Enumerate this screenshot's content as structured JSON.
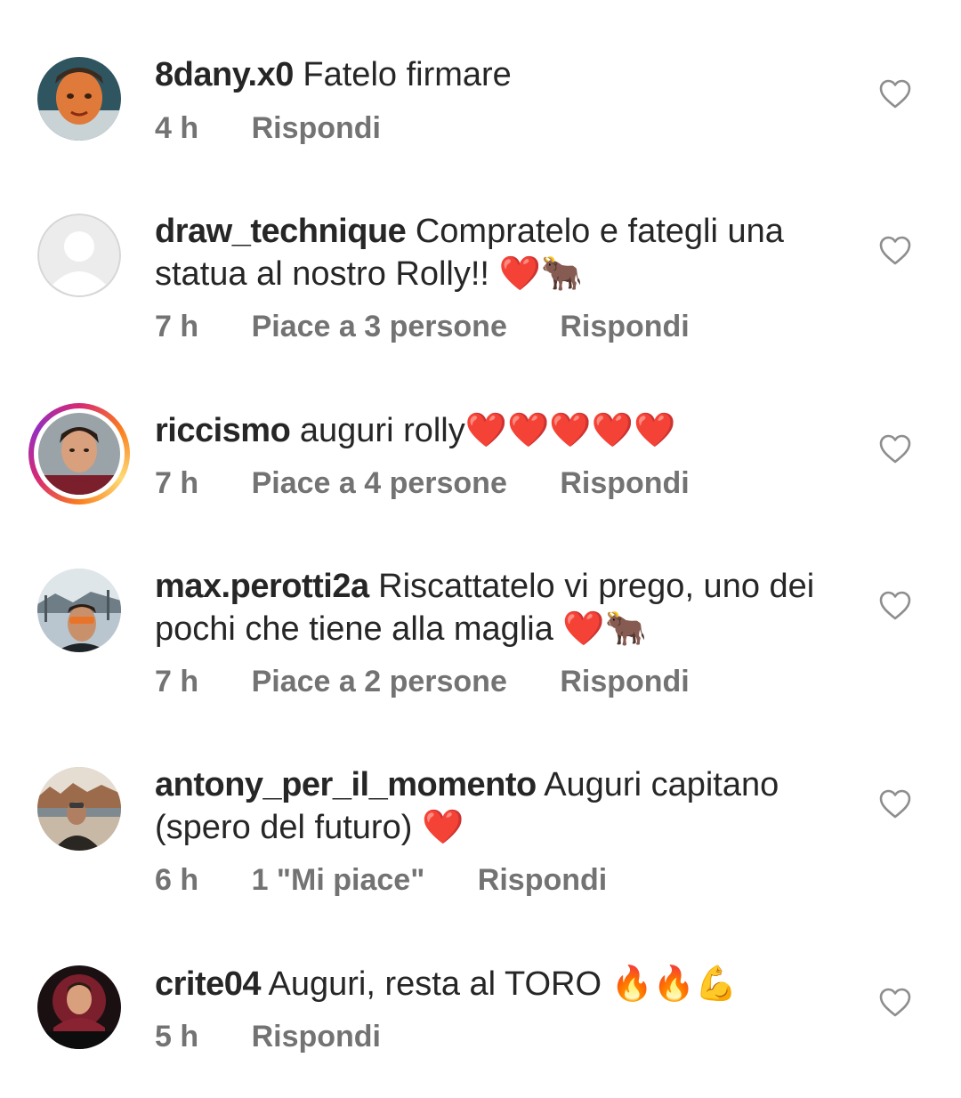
{
  "comments": [
    {
      "username": "8dany.x0",
      "text": "Fatelo firmare",
      "emoji": "",
      "time": "4 h",
      "likes": "",
      "reply": "Rispondi",
      "has_story": false
    },
    {
      "username": "draw_technique",
      "text": "Compratelo e fategli una statua al nostro Rolly!!",
      "emoji": "❤️🐂",
      "time": "7 h",
      "likes": "Piace a 3 persone",
      "reply": "Rispondi",
      "has_story": false
    },
    {
      "username": "riccismo",
      "text": "auguri rolly",
      "emoji": "❤️❤️❤️❤️❤️",
      "time": "7 h",
      "likes": "Piace a 4 persone",
      "reply": "Rispondi",
      "has_story": true
    },
    {
      "username": "max.perotti2a",
      "text": "Riscattatelo vi prego, uno dei pochi che tiene alla maglia",
      "emoji": "❤️🐂",
      "time": "7 h",
      "likes": "Piace a 2 persone",
      "reply": "Rispondi",
      "has_story": false
    },
    {
      "username": "antony_per_il_momento",
      "text": "Auguri capitano (spero del futuro)",
      "emoji": "❤️",
      "time": "6 h",
      "likes": "1 \"Mi piace\"",
      "reply": "Rispondi",
      "has_story": false
    },
    {
      "username": "crite04",
      "text": "Auguri, resta al TORO",
      "emoji": "🔥🔥💪",
      "time": "5 h",
      "likes": "",
      "reply": "Rispondi",
      "has_story": false
    }
  ],
  "icons": {
    "like": "heart-outline-icon"
  },
  "colors": {
    "text": "#262626",
    "secondary": "#737373",
    "heart_red": "#e0245e",
    "story_ring": "#d62976"
  }
}
